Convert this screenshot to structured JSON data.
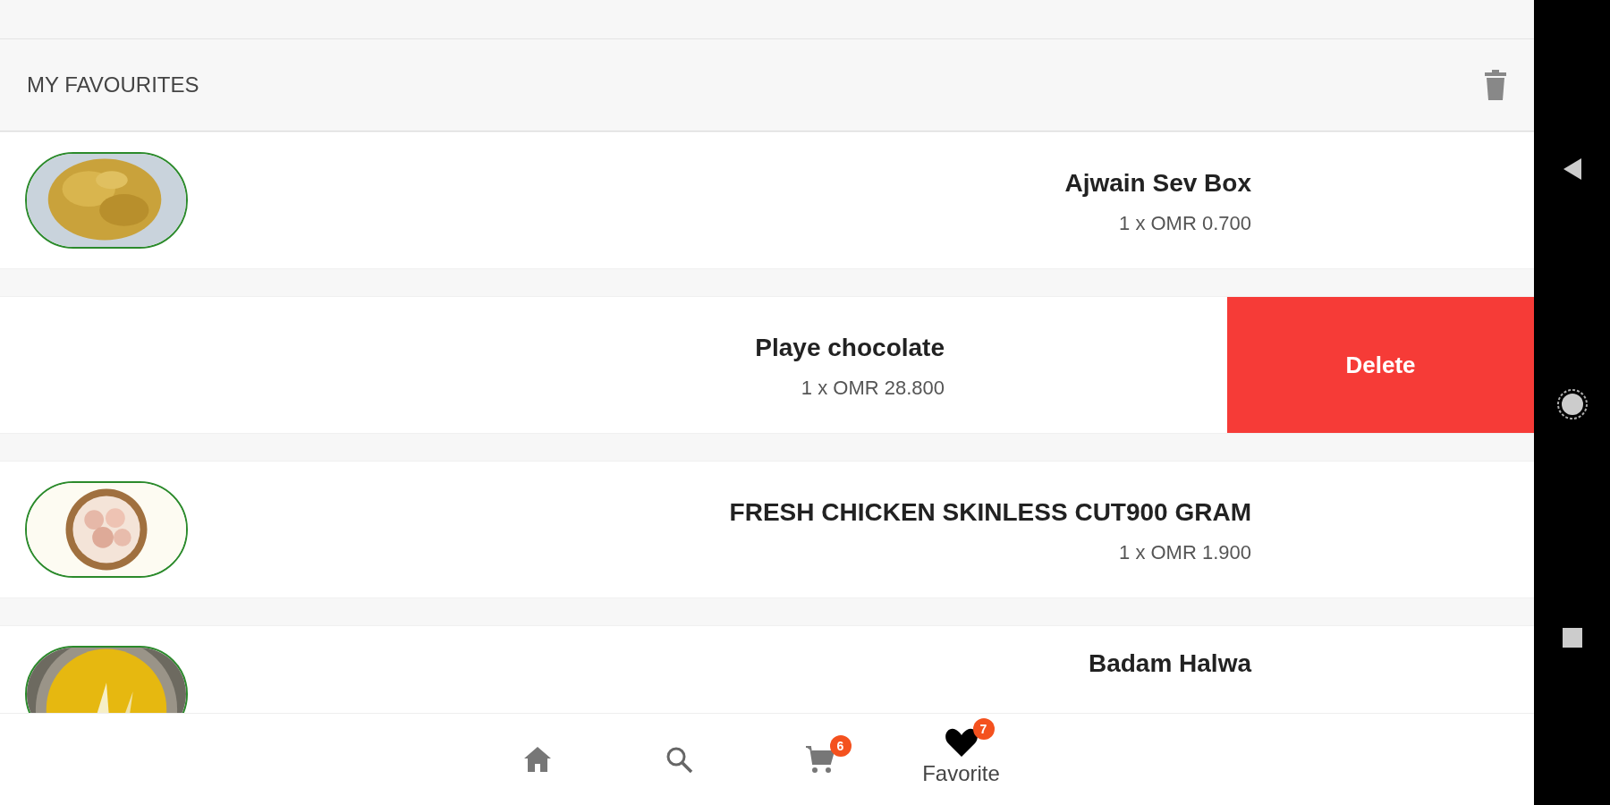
{
  "header": {
    "title": "MY FAVOURITES"
  },
  "items": [
    {
      "name": "Ajwain Sev Box",
      "price": "1 x OMR 0.700",
      "swiped": false
    },
    {
      "name": "Playe chocolate",
      "price": "1 x OMR 28.800",
      "swiped": true,
      "delete_label": "Delete"
    },
    {
      "name": "FRESH CHICKEN SKINLESS CUT900 GRAM",
      "price": "1 x OMR 1.900",
      "swiped": false
    },
    {
      "name": "Badam Halwa",
      "swiped": false
    }
  ],
  "bottom_nav": [
    {
      "kind": "home",
      "selected": false
    },
    {
      "kind": "search",
      "selected": false
    },
    {
      "kind": "cart",
      "badge": "6",
      "selected": false
    },
    {
      "kind": "favorite",
      "badge": "7",
      "label": "Favorite",
      "selected": true
    }
  ]
}
